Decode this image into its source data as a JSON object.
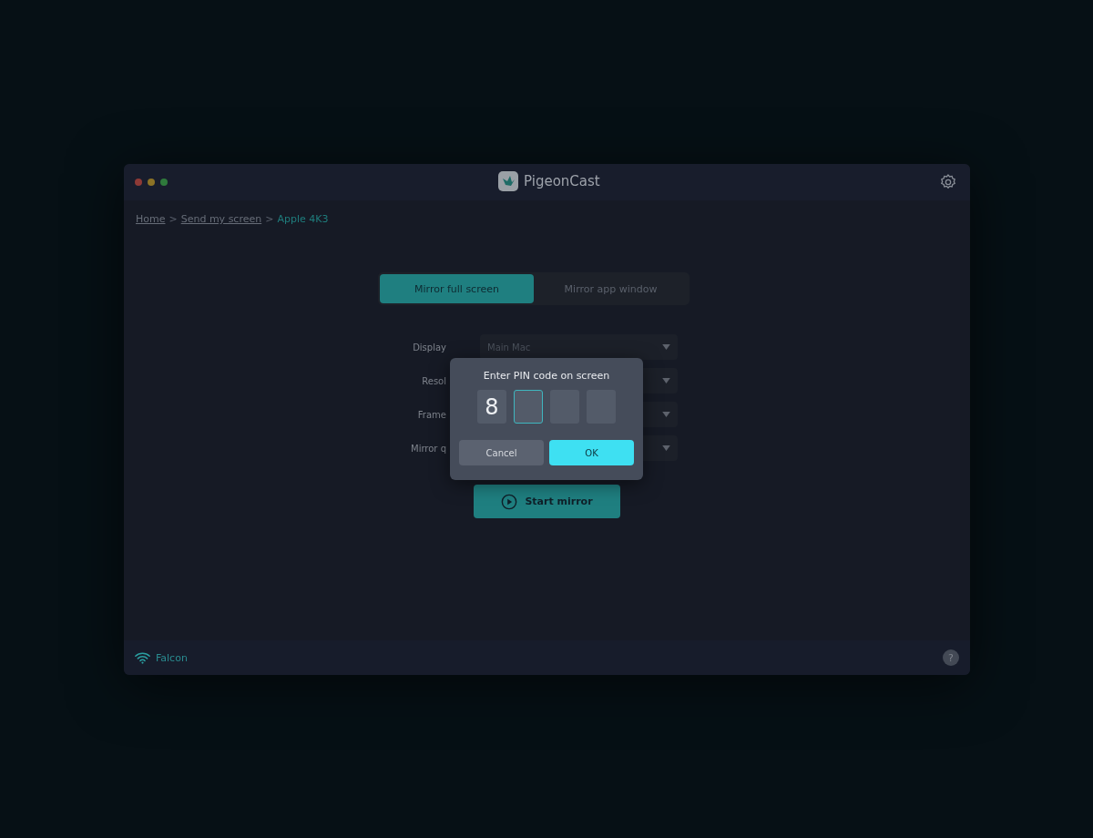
{
  "window": {
    "title": "PigeonCast"
  },
  "breadcrumb": [
    {
      "label": "Home",
      "current": false
    },
    {
      "label": "Send my screen",
      "current": false
    },
    {
      "label": "Apple 4K3",
      "current": true
    }
  ],
  "breadcrumb_separator": ">",
  "tabs": [
    {
      "label": "Mirror full screen",
      "selected": true
    },
    {
      "label": "Mirror app window",
      "selected": false
    }
  ],
  "settings": [
    {
      "label": "Display",
      "value": "Main Mac"
    },
    {
      "label": "Resol"
    },
    {
      "label": "Frame"
    },
    {
      "label": "Mirror q"
    }
  ],
  "start_button": "Start mirror",
  "status_bar": {
    "network": "Falcon",
    "help": "?"
  },
  "dialog": {
    "title": "Enter PIN code on screen",
    "pin": [
      {
        "value": "8",
        "focused": false
      },
      {
        "focused": true
      },
      {
        "focused": false
      },
      {
        "focused": false
      }
    ],
    "buttons": [
      {
        "label": "Cancel",
        "kind": "secondary"
      },
      {
        "label": "OK",
        "kind": "primary"
      }
    ]
  }
}
